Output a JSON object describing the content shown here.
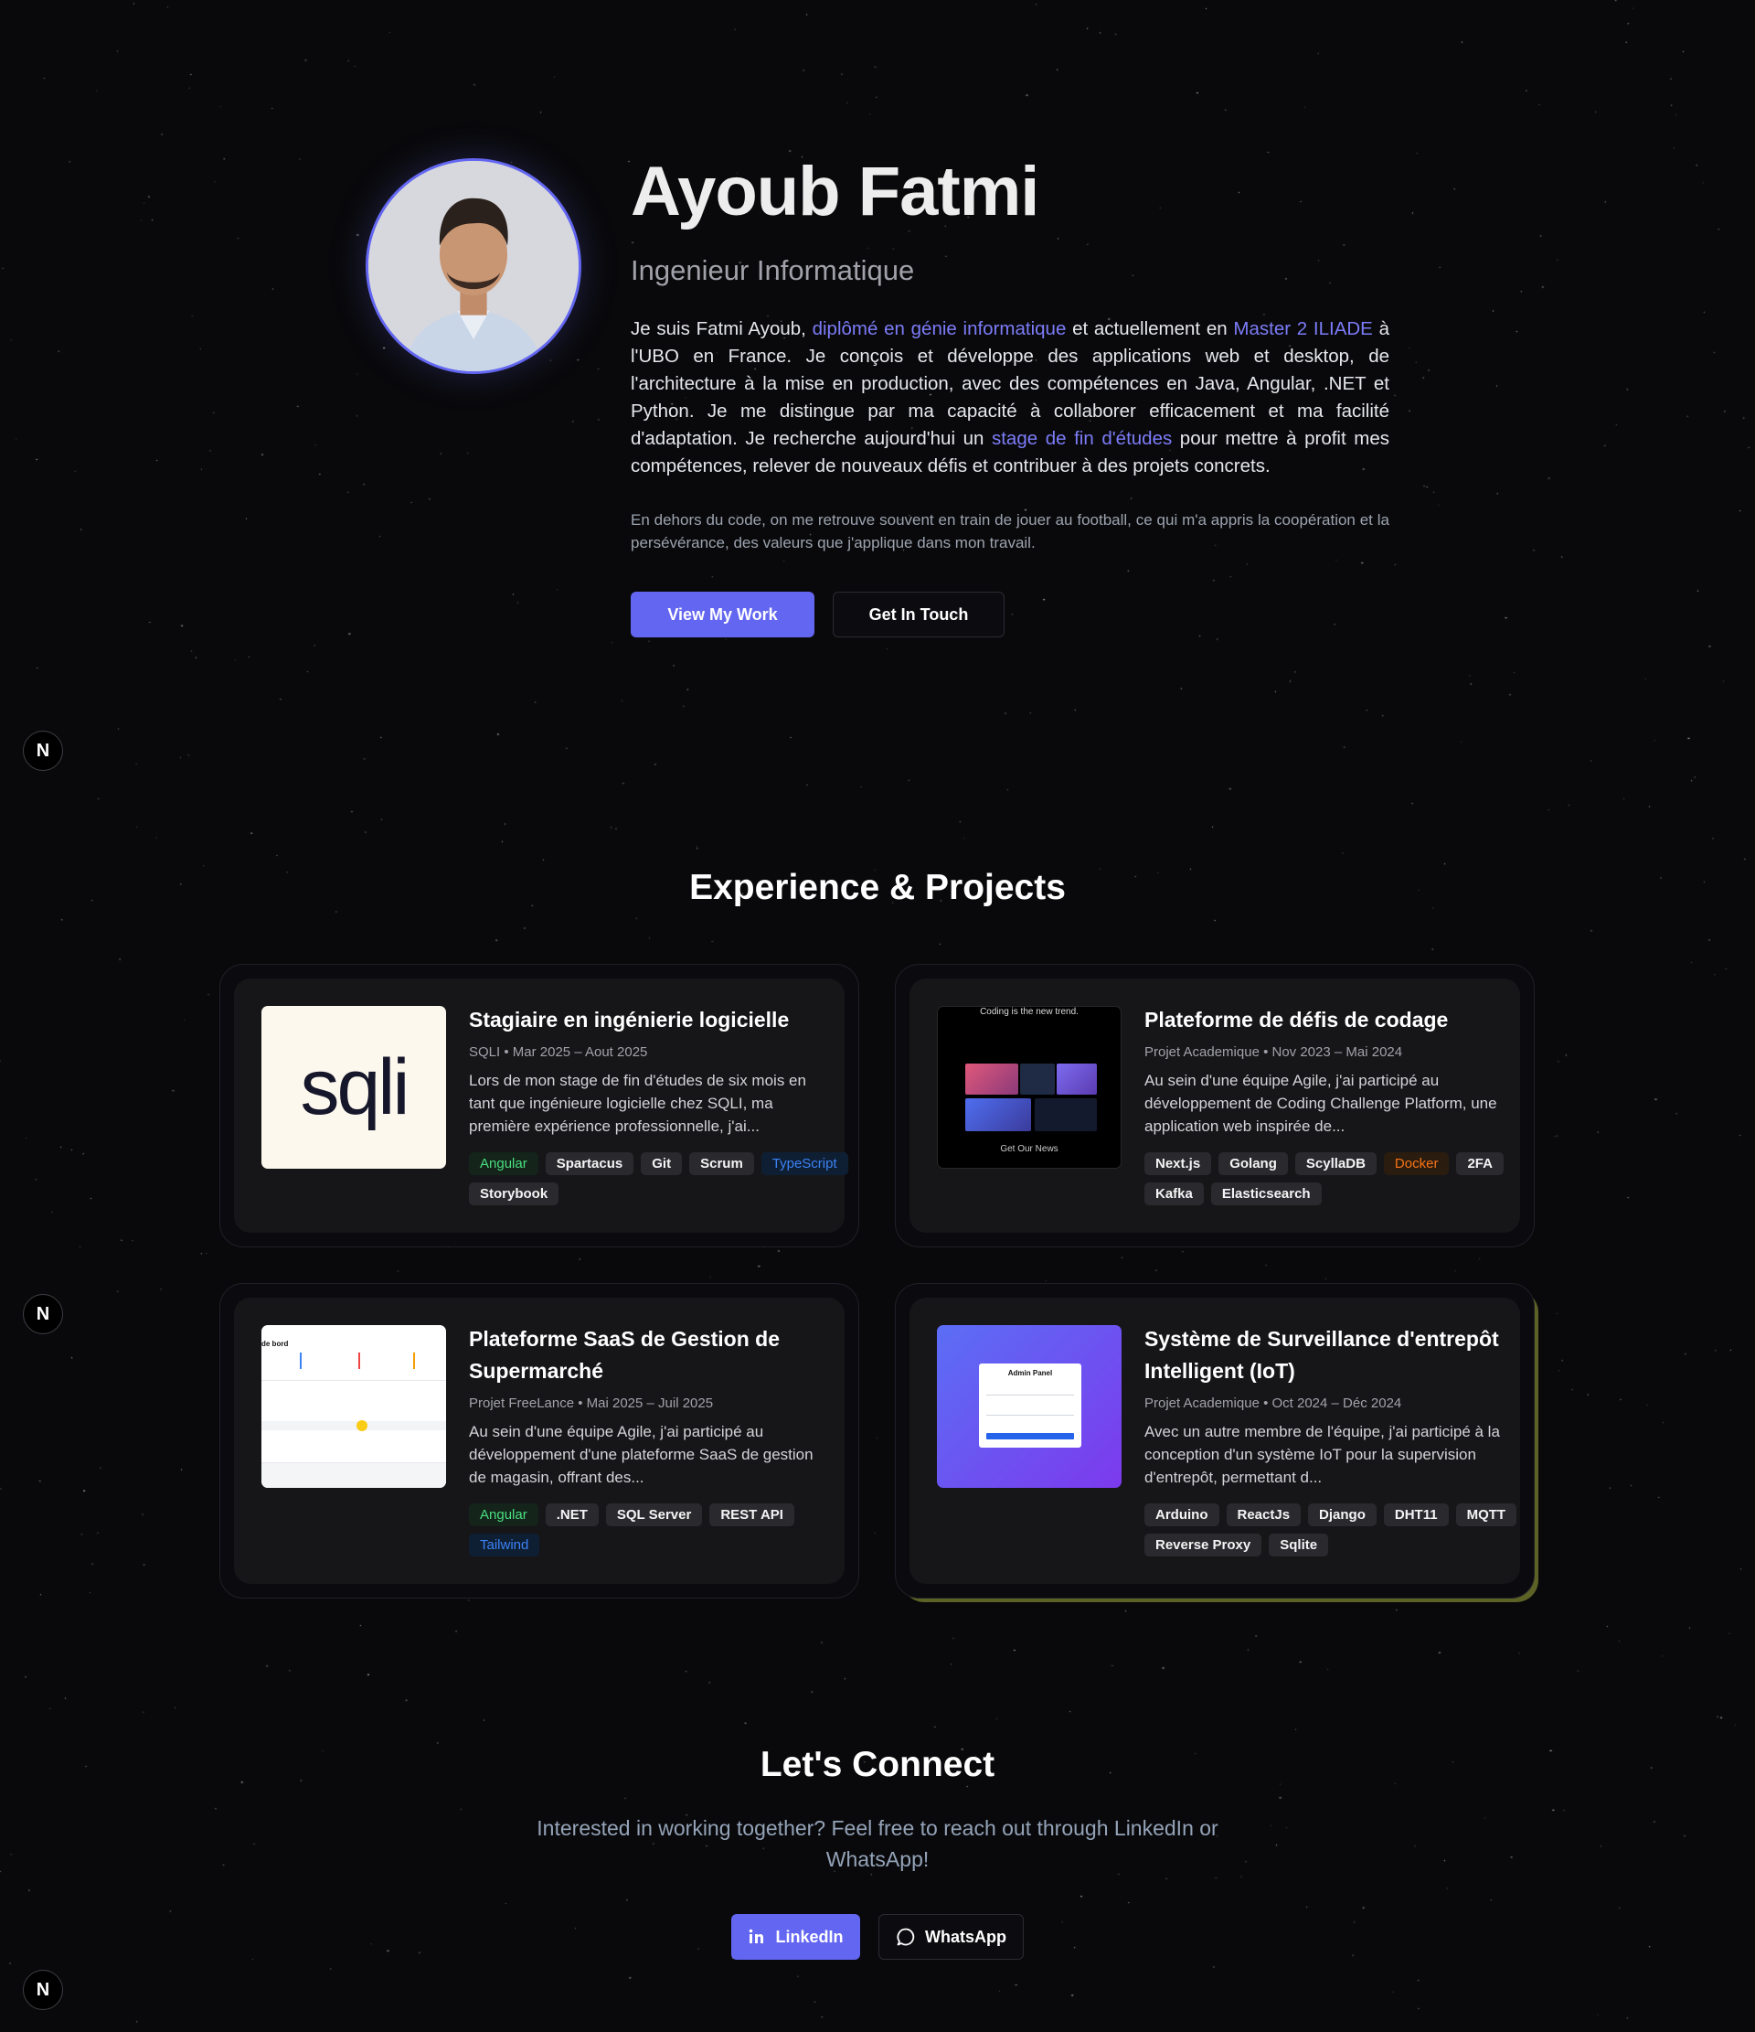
{
  "hero": {
    "name": "Ayoub Fatmi",
    "title": "Ingenieur Informatique",
    "bio": {
      "p1": "Je suis Fatmi Ayoub, ",
      "hl1": "diplômé en génie informatique",
      "p2": " et actuellement en ",
      "hl2": "Master 2 ILIADE",
      "p3": " à l'UBO en France. Je conçois et développe des applications web et desktop, de l'architecture à la mise en production, avec des compétences en Java, Angular, .NET et Python. Je me distingue par ma capacité à collaborer efficacement et ma facilité d'adaptation. Je recherche aujourd'hui un ",
      "hl3": "stage de fin d'études",
      "p4": " pour mettre à profit mes compétences, relever de nouveaux défis et contribuer à des projets concrets."
    },
    "bio2": "En dehors du code, on me retrouve souvent en train de jouer au football, ce qui m'a appris la coopération et la persévérance, des valeurs que j'applique dans mon travail.",
    "primary_button": "View My Work",
    "secondary_button": "Get In Touch"
  },
  "badge_letter": "N",
  "experience": {
    "title": "Experience & Projects",
    "cards": [
      {
        "title": "Stagiaire en ingénierie logicielle",
        "meta": "SQLI • Mar 2025 – Aout 2025",
        "description": "Lors de mon stage de fin d'études de six mois en tant que ingénieure logicielle chez SQLI, ma première expérience professionnelle, j'ai...",
        "logo_text": "sqli",
        "tags": [
          {
            "label": "Angular",
            "style": "green"
          },
          {
            "label": "Spartacus",
            "style": "gray"
          },
          {
            "label": "Git",
            "style": "gray"
          },
          {
            "label": "Scrum",
            "style": "gray"
          },
          {
            "label": "TypeScript",
            "style": "blue"
          },
          {
            "label": "Storybook",
            "style": "gray"
          }
        ]
      },
      {
        "title": "Plateforme de défis de codage",
        "meta": "Projet Academique • Nov 2023 – Mai 2024",
        "description": "Au sein d'une équipe Agile, j'ai participé au développement de Coding Challenge Platform, une application web inspirée de...",
        "thumb_top": "Coding is the new trend.",
        "thumb_bottom": "Get Our News",
        "tags": [
          {
            "label": "Next.js",
            "style": "gray"
          },
          {
            "label": "Golang",
            "style": "gray"
          },
          {
            "label": "ScyllaDB",
            "style": "gray"
          },
          {
            "label": "Docker",
            "style": "orange"
          },
          {
            "label": "2FA",
            "style": "gray"
          },
          {
            "label": "Kafka",
            "style": "gray"
          },
          {
            "label": "Elasticsearch",
            "style": "gray"
          }
        ]
      },
      {
        "title": "Plateforme SaaS de Gestion de Supermarché",
        "meta": "Projet FreeLance • Mai 2025 – Juil 2025",
        "description": "Au sein d'une équipe Agile, j'ai participé au développement d'une plateforme SaaS de gestion de magasin, offrant des...",
        "thumb_label": "de bord",
        "tags": [
          {
            "label": "Angular",
            "style": "green"
          },
          {
            "label": ".NET",
            "style": "gray"
          },
          {
            "label": "SQL Server",
            "style": "gray"
          },
          {
            "label": "REST API",
            "style": "gray"
          },
          {
            "label": "Tailwind",
            "style": "blue"
          }
        ]
      },
      {
        "title": "Système de Surveillance d'entrepôt Intelligent (IoT)",
        "meta": "Projet Academique • Oct 2024 – Déc 2024",
        "description": "Avec un autre membre de l'équipe, j'ai participé à la conception d'un système IoT pour la supervision d'entrepôt, permettant d...",
        "thumb_label": "Admin Panel",
        "tags": [
          {
            "label": "Arduino",
            "style": "gray"
          },
          {
            "label": "ReactJs",
            "style": "gray"
          },
          {
            "label": "Django",
            "style": "gray"
          },
          {
            "label": "DHT11",
            "style": "gray"
          },
          {
            "label": "MQTT",
            "style": "gray"
          },
          {
            "label": "Reverse Proxy",
            "style": "gray"
          },
          {
            "label": "Sqlite",
            "style": "gray"
          }
        ]
      }
    ]
  },
  "connect": {
    "title": "Let's Connect",
    "text": "Interested in working together? Feel free to reach out through LinkedIn or WhatsApp!",
    "linkedin_label": "LinkedIn",
    "whatsapp_label": "WhatsApp"
  },
  "icons": {
    "linkedin": "linkedin-icon",
    "whatsapp": "whatsapp-icon"
  },
  "colors": {
    "accent": "#6366f1",
    "background": "#09090b",
    "card": "#161619",
    "tag_green": "#4ade80",
    "tag_blue": "#3b82f6",
    "tag_orange": "#f97316"
  }
}
